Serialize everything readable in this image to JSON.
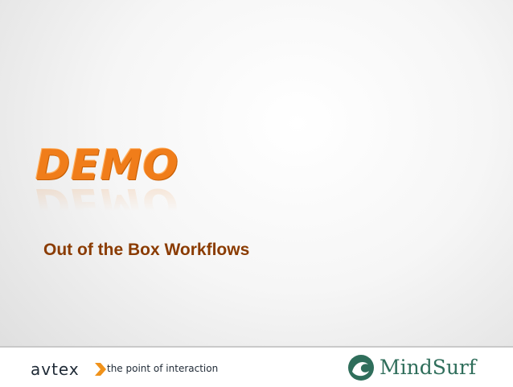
{
  "slide": {
    "demo_title": "DEMO",
    "subtitle": "Out of the Box Workflows"
  },
  "footer": {
    "avtex_brand": "avtex",
    "avtex_tagline": "the point of interaction",
    "mindsurf_brand": "MindSurf"
  },
  "colors": {
    "demo_orange": "#f07d1a",
    "subtitle_brown": "#8a3b00",
    "avtex_navy": "#1f2a36",
    "avtex_chevron": "#f0921a",
    "mindsurf_green": "#2f6e5b"
  }
}
